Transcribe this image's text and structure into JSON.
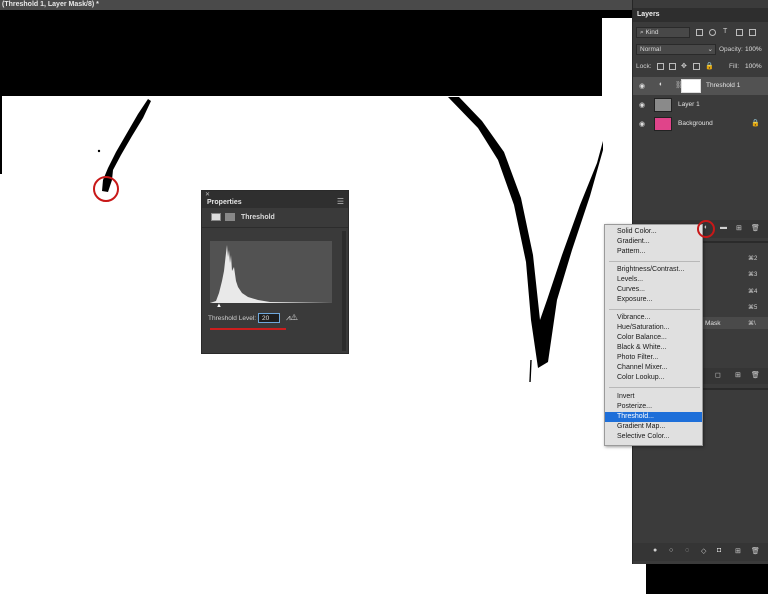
{
  "document": {
    "tab_title": "(Threshold 1, Layer Mask/8) *"
  },
  "properties": {
    "title": "Properties",
    "adjustment_name": "Threshold",
    "threshold_label": "Threshold Level:",
    "threshold_value": "20"
  },
  "layers": {
    "tab": "Layers",
    "filter_kind": "Kind",
    "blend_mode": "Normal",
    "opacity_label": "Opacity:",
    "opacity_value": "100%",
    "lock_label": "Lock:",
    "fill_label": "Fill:",
    "fill_value": "100%",
    "items": [
      {
        "name": "Threshold 1"
      },
      {
        "name": "Layer 1"
      },
      {
        "name": "Background"
      }
    ]
  },
  "channels": {
    "hotkeys": [
      "⌘2",
      "⌘3",
      "⌘4",
      "⌘5",
      "⌘\\"
    ],
    "mask_label": "Mask"
  },
  "adjustment_menu": {
    "groups": [
      [
        "Solid Color...",
        "Gradient...",
        "Pattern..."
      ],
      [
        "Brightness/Contrast...",
        "Levels...",
        "Curves...",
        "Exposure..."
      ],
      [
        "Vibrance...",
        "Hue/Saturation...",
        "Color Balance...",
        "Black & White...",
        "Photo Filter...",
        "Channel Mixer...",
        "Color Lookup..."
      ],
      [
        "Invert",
        "Posterize...",
        "Threshold...",
        "Gradient Map...",
        "Selective Color..."
      ]
    ],
    "selected": "Threshold..."
  },
  "colors": {
    "highlight": "#1e6fd9",
    "annotation_red": "#c81818",
    "panel_bg": "#3b3b3b",
    "background_thumb": "#e0448a"
  },
  "icons": {
    "eye": "eye-icon",
    "adjustment": "adjustment-layer-icon",
    "lock": "lock-icon",
    "folder": "folder-icon",
    "new_layer": "new-layer-icon",
    "trash": "trash-icon"
  }
}
